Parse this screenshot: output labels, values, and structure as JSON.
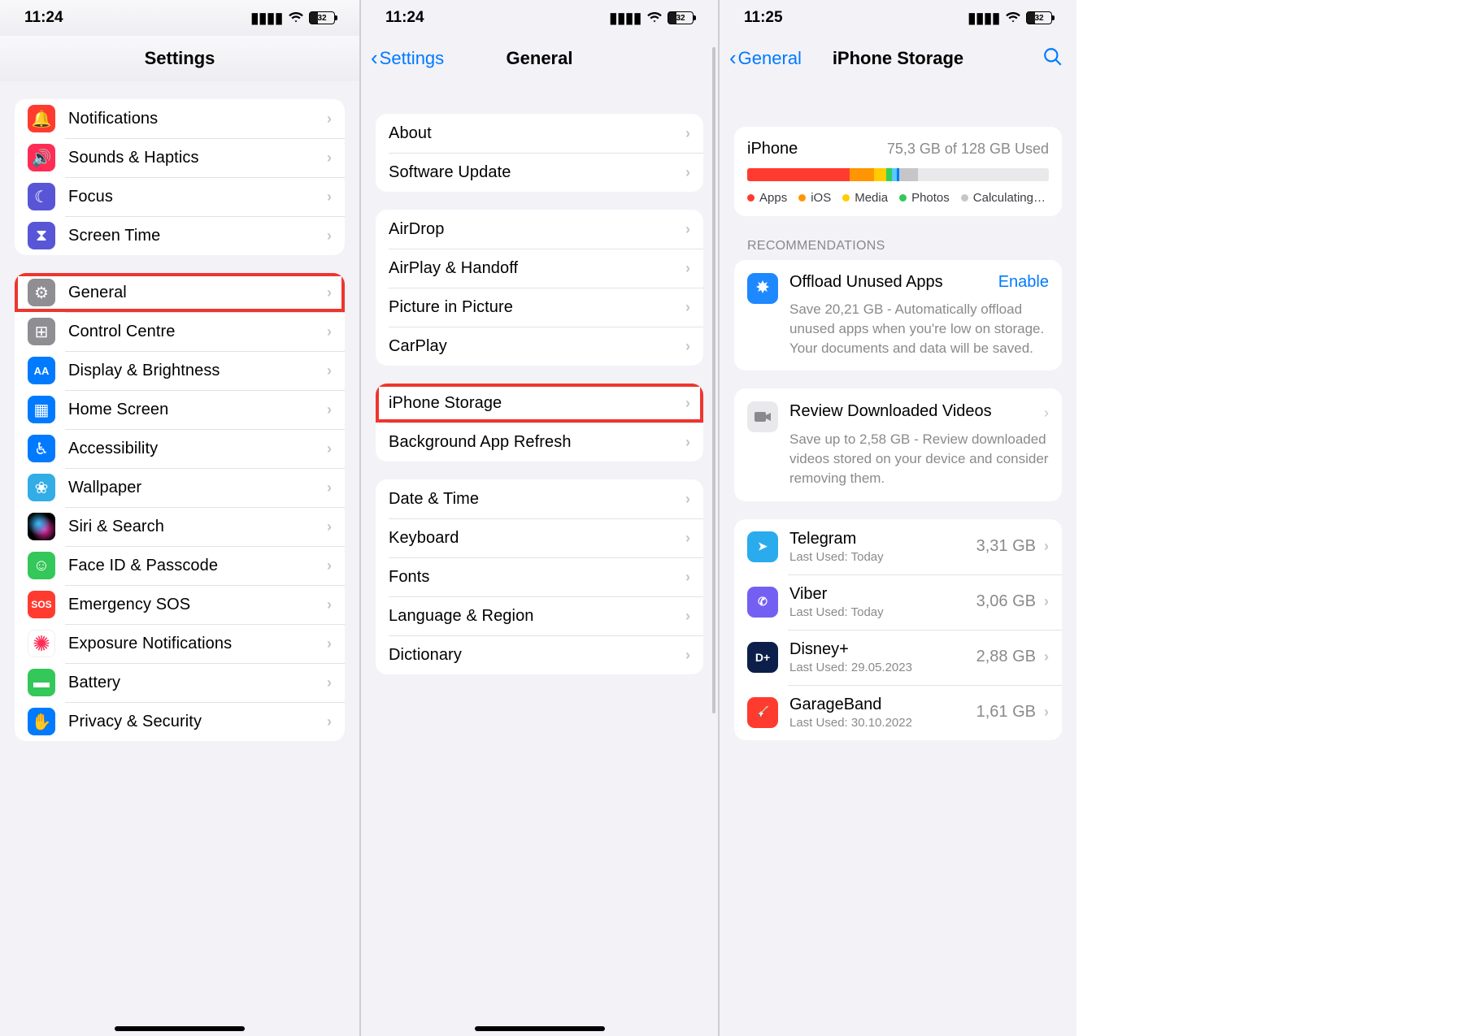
{
  "phone1": {
    "status": {
      "time": "11:24",
      "battery": "32"
    },
    "title": "Settings",
    "group1": [
      {
        "id": "notifications",
        "label": "Notifications",
        "color": "ic-red",
        "glyph": "🔔"
      },
      {
        "id": "sounds",
        "label": "Sounds & Haptics",
        "color": "ic-pink",
        "glyph": "🔊"
      },
      {
        "id": "focus",
        "label": "Focus",
        "color": "ic-indigo",
        "glyph": "☾"
      },
      {
        "id": "screentime",
        "label": "Screen Time",
        "color": "ic-indigo",
        "glyph": "⧗"
      }
    ],
    "group2": [
      {
        "id": "general",
        "label": "General",
        "color": "ic-gray",
        "glyph": "⚙",
        "highlight": true
      },
      {
        "id": "controlcentre",
        "label": "Control Centre",
        "color": "ic-gray",
        "glyph": "⊞"
      },
      {
        "id": "display",
        "label": "Display & Brightness",
        "color": "ic-blue",
        "glyph": "AA"
      },
      {
        "id": "homescreen",
        "label": "Home Screen",
        "color": "ic-blue",
        "glyph": "▦"
      },
      {
        "id": "accessibility",
        "label": "Accessibility",
        "color": "ic-blue",
        "glyph": "♿︎"
      },
      {
        "id": "wallpaper",
        "label": "Wallpaper",
        "color": "ic-cyan",
        "glyph": "❀"
      },
      {
        "id": "siri",
        "label": "Siri & Search",
        "color": "ic-siri",
        "glyph": ""
      },
      {
        "id": "faceid",
        "label": "Face ID & Passcode",
        "color": "ic-green",
        "glyph": "☺"
      },
      {
        "id": "sos",
        "label": "Emergency SOS",
        "color": "ic-sos",
        "glyph": "SOS"
      },
      {
        "id": "exposure",
        "label": "Exposure Notifications",
        "color": "ic-exposure",
        "glyph": "✺"
      },
      {
        "id": "battery",
        "label": "Battery",
        "color": "ic-green",
        "glyph": "▬"
      },
      {
        "id": "privacy",
        "label": "Privacy & Security",
        "color": "ic-hand",
        "glyph": "✋"
      }
    ]
  },
  "phone2": {
    "status": {
      "time": "11:24",
      "battery": "32"
    },
    "back": "Settings",
    "title": "General",
    "group1": [
      {
        "id": "about",
        "label": "About"
      },
      {
        "id": "softwareupdate",
        "label": "Software Update"
      }
    ],
    "group2": [
      {
        "id": "airdrop",
        "label": "AirDrop"
      },
      {
        "id": "airplay",
        "label": "AirPlay & Handoff"
      },
      {
        "id": "pip",
        "label": "Picture in Picture"
      },
      {
        "id": "carplay",
        "label": "CarPlay"
      }
    ],
    "group3": [
      {
        "id": "storage",
        "label": "iPhone Storage",
        "highlight": true
      },
      {
        "id": "bgrefresh",
        "label": "Background App Refresh"
      }
    ],
    "group4": [
      {
        "id": "datetime",
        "label": "Date & Time"
      },
      {
        "id": "keyboard",
        "label": "Keyboard"
      },
      {
        "id": "fonts",
        "label": "Fonts"
      },
      {
        "id": "language",
        "label": "Language & Region"
      },
      {
        "id": "dictionary",
        "label": "Dictionary"
      }
    ]
  },
  "phone3": {
    "status": {
      "time": "11:25",
      "battery": "32"
    },
    "back": "General",
    "title": "iPhone Storage",
    "storage": {
      "device": "iPhone",
      "used_text": "75,3 GB of 128 GB Used",
      "legend": [
        {
          "label": "Apps",
          "color": "#ff3b30"
        },
        {
          "label": "iOS",
          "color": "#ff9500"
        },
        {
          "label": "Media",
          "color": "#ffcc00"
        },
        {
          "label": "Photos",
          "color": "#34c759"
        },
        {
          "label": "Calculating…",
          "color": "#c6c6c9"
        }
      ]
    },
    "reco_header": "RECOMMENDATIONS",
    "reco1": {
      "title": "Offload Unused Apps",
      "action": "Enable",
      "desc": "Save 20,21 GB - Automatically offload unused apps when you're low on storage. Your documents and data will be saved."
    },
    "reco2": {
      "title": "Review Downloaded Videos",
      "desc": "Save up to 2,58 GB - Review downloaded videos stored on your device and consider removing them."
    },
    "apps": [
      {
        "name": "Telegram",
        "sub": "Last Used: Today",
        "size": "3,31 GB",
        "iconColor": "#2aabee",
        "glyph": "➤"
      },
      {
        "name": "Viber",
        "sub": "Last Used: Today",
        "size": "3,06 GB",
        "iconColor": "#7360f2",
        "glyph": "✆"
      },
      {
        "name": "Disney+",
        "sub": "Last Used: 29.05.2023",
        "size": "2,88 GB",
        "iconColor": "#0c1f4a",
        "glyph": "D+"
      },
      {
        "name": "GarageBand",
        "sub": "Last Used: 30.10.2022",
        "size": "1,61 GB",
        "iconColor": "#ff3b30",
        "glyph": "🎸"
      }
    ]
  }
}
